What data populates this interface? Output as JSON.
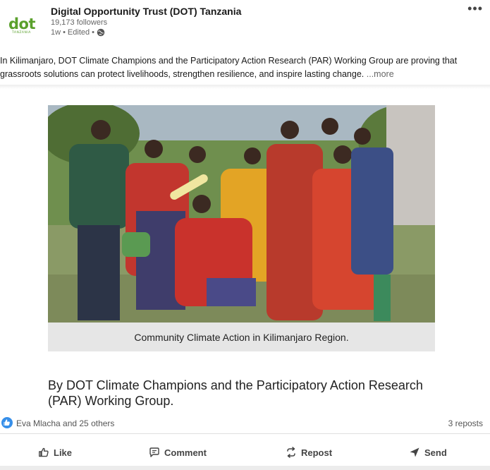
{
  "post": {
    "author": "Digital Opportunity Trust (DOT) Tanzania",
    "followers": "19,173 followers",
    "time": "1w",
    "edited": "Edited",
    "separator1": "•",
    "separator2": "•",
    "more_menu": "•••",
    "logo_text": "dot",
    "logo_sub": "TANZANIA",
    "text": "In Kilimanjaro, DOT Climate Champions and the Participatory Action Research (PAR) Working Group are proving that grassroots solutions can protect livelihoods, strengthen resilience, and inspire lasting change.",
    "see_more": "...more",
    "image_caption": "Community Climate Action in Kilimanjaro Region.",
    "article_title": "By DOT Climate Champions and the Participatory Action Research (PAR) Working Group."
  },
  "social": {
    "reactors": "Eva Mlacha and 25 others",
    "reposts": "3 reposts"
  },
  "actions": {
    "like": "Like",
    "comment": "Comment",
    "repost": "Repost",
    "send": "Send"
  },
  "colors": {
    "brand_green": "#5aa02c",
    "like_blue": "#378fe9"
  },
  "icons": [
    "globe-icon",
    "more-icon",
    "like-icon",
    "comment-icon",
    "repost-icon",
    "send-icon",
    "like-reaction-icon"
  ]
}
